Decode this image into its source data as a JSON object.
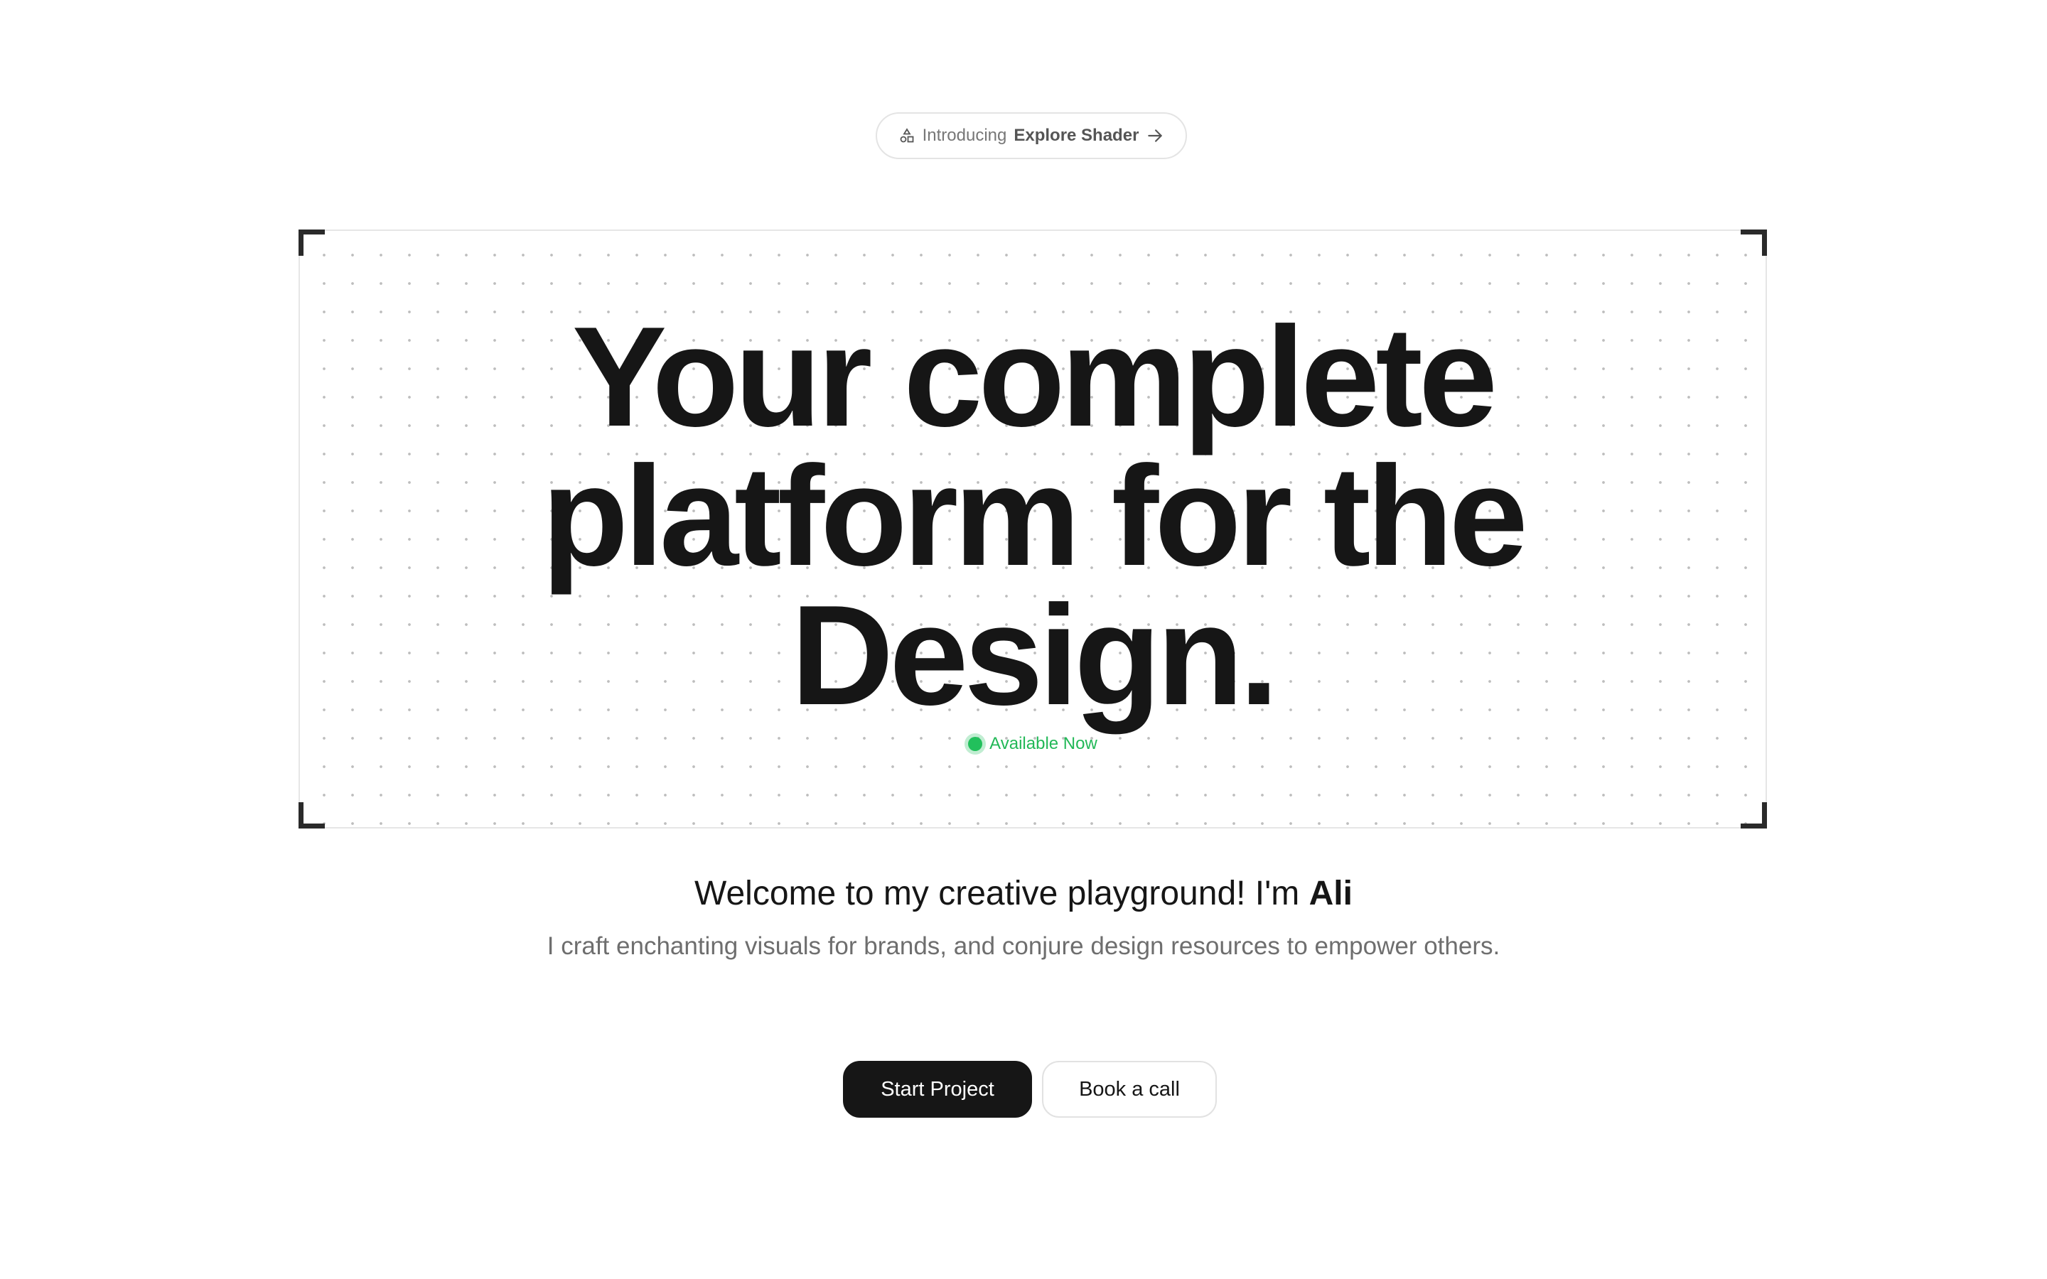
{
  "announcement": {
    "icon": "shapes-icon",
    "prefix": "Introducing",
    "highlight": "Explore Shader",
    "arrow_icon": "arrow-right-icon"
  },
  "hero": {
    "headline_lines": [
      "Your complete",
      "platform for the",
      "Design."
    ],
    "status_label": "Available Now",
    "status_color": "#22c05c"
  },
  "intro": {
    "welcome_text": "Welcome to my creative playground! I'm",
    "name": "Ali",
    "subtitle": "I craft enchanting visuals for brands, and conjure design resources to empower others."
  },
  "actions": {
    "primary_label": "Start Project",
    "secondary_label": "Book a call"
  },
  "colors": {
    "text": "#161616",
    "muted": "#6e6e6e",
    "accent_green": "#22b857",
    "border": "#e4e4e4"
  }
}
